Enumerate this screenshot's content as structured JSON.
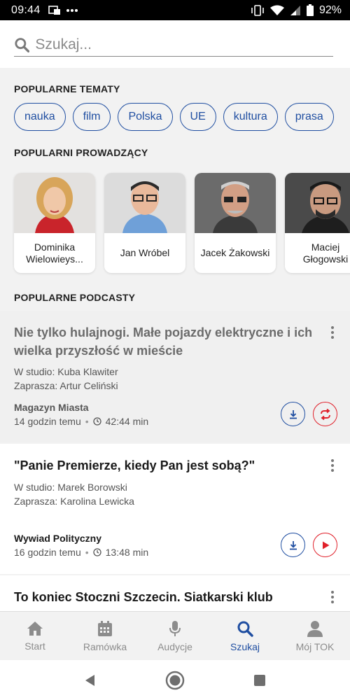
{
  "status_bar": {
    "time": "09:44",
    "battery": "92%"
  },
  "search": {
    "placeholder": "Szukaj..."
  },
  "topics": {
    "heading": "POPULARNE TEMATY",
    "items": [
      "nauka",
      "film",
      "Polska",
      "UE",
      "kultura",
      "prasa"
    ]
  },
  "hosts": {
    "heading": "POPULARNI PROWADZĄCY",
    "items": [
      {
        "name": "Dominika Wielowieys..."
      },
      {
        "name": "Jan Wróbel"
      },
      {
        "name": "Jacek Żakowski"
      },
      {
        "name": "Maciej Głogowski"
      }
    ]
  },
  "podcasts": {
    "heading": "POPULARNE PODCASTY",
    "items": [
      {
        "title": "Nie tylko hulajnogi. Małe pojazdy elektryczne i ich wielka przyszłość w mieście",
        "studio": "W studio: Kuba Klawiter",
        "invites": "Zaprasza: Artur Celiński",
        "show": "Magazyn Miasta",
        "age": "14 godzin temu",
        "duration": "42:44 min"
      },
      {
        "title": "\"Panie Premierze, kiedy Pan jest sobą?\"",
        "studio": "W studio: Marek Borowski",
        "invites": "Zaprasza: Karolina Lewicka",
        "show": "Wywiad Polityczny",
        "age": "16 godzin temu",
        "duration": "13:48 min"
      },
      {
        "title": "To koniec Stoczni Szczecin. Siatkarski klub"
      }
    ]
  },
  "bottom_nav": {
    "items": [
      {
        "label": "Start",
        "icon": "home-icon"
      },
      {
        "label": "Ramówka",
        "icon": "calendar-icon"
      },
      {
        "label": "Audycje",
        "icon": "microphone-icon"
      },
      {
        "label": "Szukaj",
        "icon": "search-icon",
        "active": true
      },
      {
        "label": "Mój TOK",
        "icon": "user-icon"
      }
    ]
  },
  "colors": {
    "accent": "#1f4ea1",
    "red": "#e0202a"
  }
}
